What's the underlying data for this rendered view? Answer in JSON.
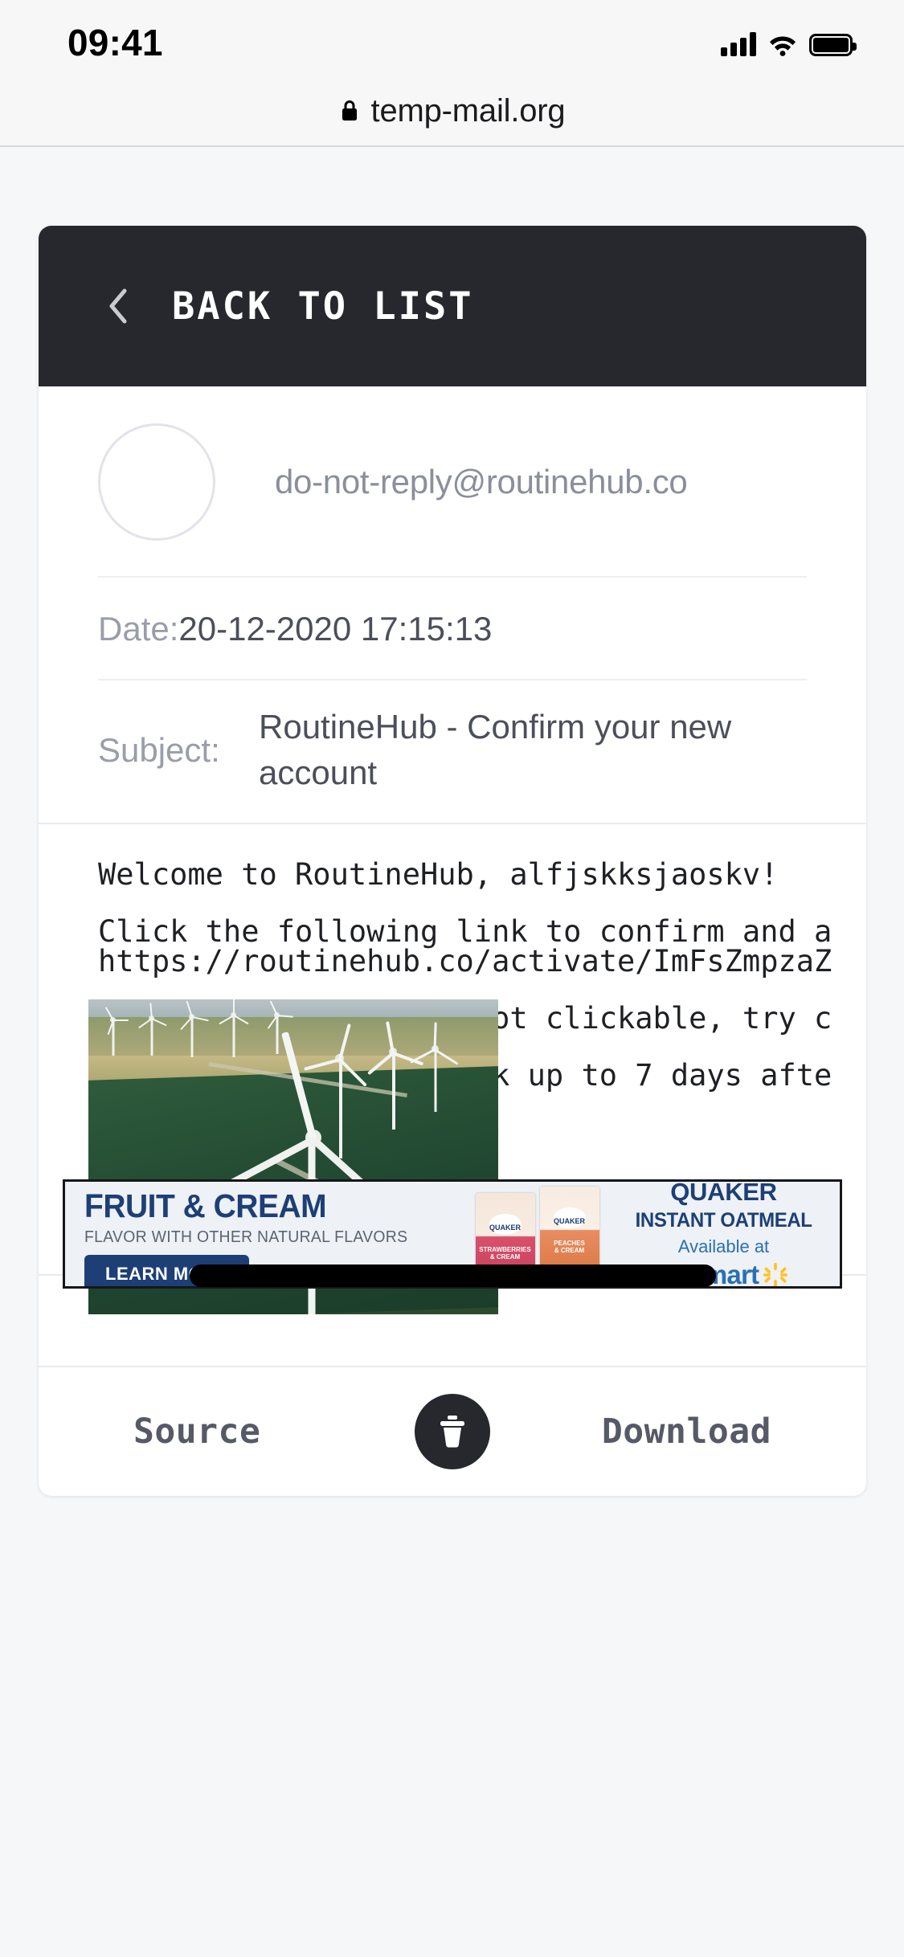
{
  "status_bar": {
    "time": "09:41",
    "signal_icon": "signal-bars-icon",
    "wifi_icon": "wifi-icon",
    "battery_icon": "battery-icon"
  },
  "browser": {
    "lock_icon": "lock-icon",
    "url": "temp-mail.org"
  },
  "mail": {
    "back_label": "BACK TO LIST",
    "back_icon": "chevron-left-icon",
    "sender_email": "do-not-reply@routinehub.co",
    "date_label": "Date:",
    "date_value": "20-12-2020 17:15:13",
    "subject_label": "Subject:",
    "subject_value": "RoutineHub - Confirm your new account",
    "body_lines": [
      "Welcome to RoutineHub, alfjskksjaoskv!",
      "",
      "Click the following link to confirm and a",
      "https://routinehub.co/activate/ImFsZmpzaZ",
      "",
      "If the above link is not clickable, try c",
      "",
      "The link will only work up to 7 days afte"
    ],
    "footer": {
      "source_label": "Source",
      "delete_icon": "trash-icon",
      "download_label": "Download"
    }
  },
  "media": {
    "alt": "wind-turbines-in-green-field-video"
  },
  "ad": {
    "headline": "FRUIT & CREAM",
    "subhead": "FLAVOR WITH OTHER NATURAL FLAVORS",
    "cta_label": "LEARN MORE",
    "brand": "QUAKER",
    "product": "INSTANT OATMEAL",
    "availability": "Available at",
    "retailer": "Walmart",
    "retailer_icon": "walmart-spark-icon",
    "packs": [
      {
        "brand": "QUAKER",
        "flavor": "STRAWBERRIES\n& CREAM"
      },
      {
        "brand": "QUAKER",
        "flavor": "PEACHES\n& CREAM"
      }
    ]
  },
  "colors": {
    "header_dark": "#26282d",
    "page_bg": "#f6f7f9",
    "ad_blue": "#1d3f76",
    "walmart_blue": "#2a6fb5",
    "walmart_yellow": "#ffc220"
  }
}
